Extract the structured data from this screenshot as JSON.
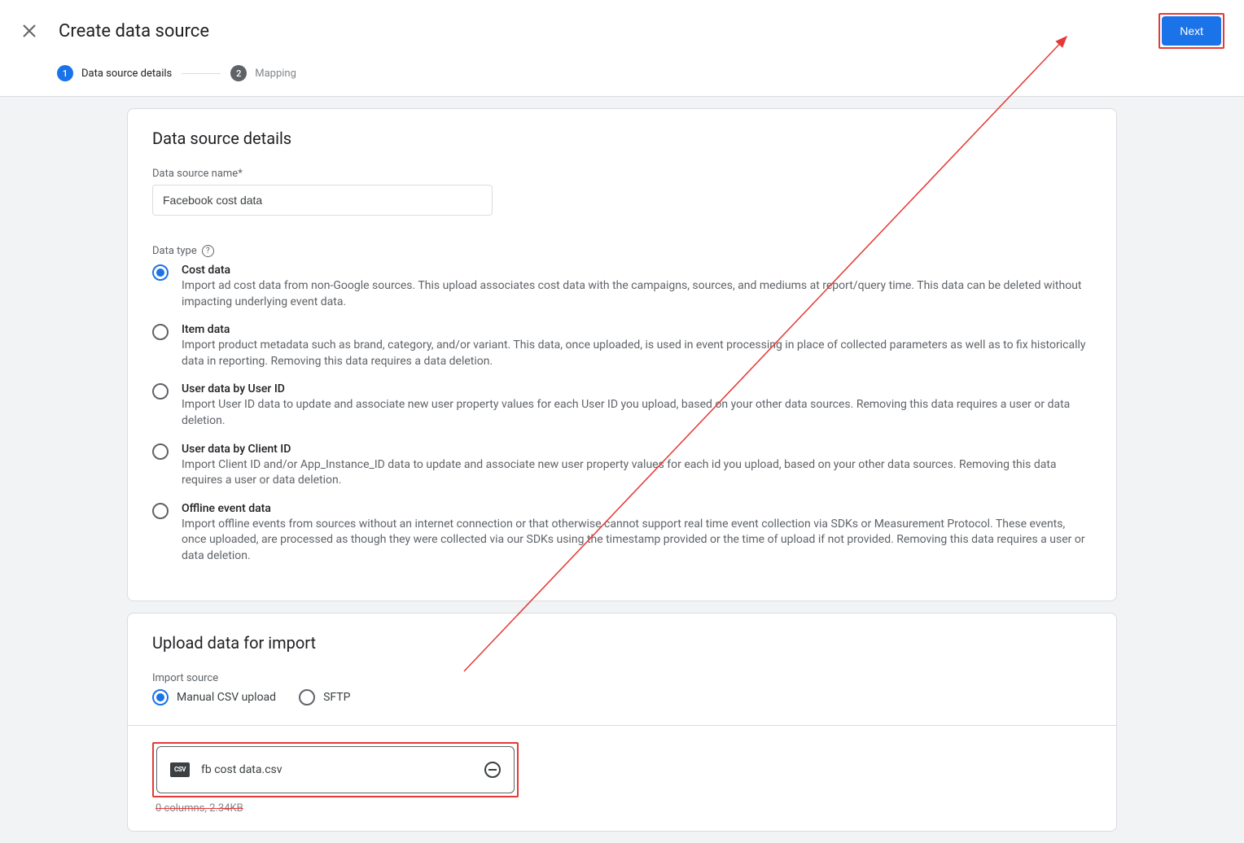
{
  "header": {
    "title": "Create data source",
    "next_label": "Next"
  },
  "stepper": {
    "step1": {
      "num": "1",
      "label": "Data source details"
    },
    "step2": {
      "num": "2",
      "label": "Mapping"
    }
  },
  "details": {
    "section_title": "Data source details",
    "name_label": "Data source name*",
    "name_value": "Facebook cost data",
    "type_label": "Data type",
    "options": [
      {
        "title": "Cost data",
        "desc": "Import ad cost data from non-Google sources. This upload associates cost data with the campaigns, sources, and mediums at report/query time. This data can be deleted without impacting underlying event data.",
        "selected": true
      },
      {
        "title": "Item data",
        "desc": "Import product metadata such as brand, category, and/or variant. This data, once uploaded, is used in event processing in place of collected parameters as well as to fix historically data in reporting. Removing this data requires a data deletion.",
        "selected": false
      },
      {
        "title": "User data by User ID",
        "desc": "Import User ID data to update and associate new user property values for each User ID you upload, based on your other data sources. Removing this data requires a user or data deletion.",
        "selected": false
      },
      {
        "title": "User data by Client ID",
        "desc": "Import Client ID and/or App_Instance_ID data to update and associate new user property values for each id you upload, based on your other data sources. Removing this data requires a user or data deletion.",
        "selected": false
      },
      {
        "title": "Offline event data",
        "desc": "Import offline events from sources without an internet connection or that otherwise cannot support real time event collection via SDKs or Measurement Protocol. These events, once uploaded, are processed as though they were collected via our SDKs using the timestamp provided or the time of upload if not provided. Removing this data requires a user or data deletion.",
        "selected": false
      }
    ]
  },
  "upload": {
    "section_title": "Upload data for import",
    "source_label": "Import source",
    "options": [
      {
        "label": "Manual CSV upload",
        "selected": true
      },
      {
        "label": "SFTP",
        "selected": false
      }
    ],
    "file": {
      "badge": "CSV",
      "name": "fb cost data.csv",
      "meta": "0 columns, 2.34KB"
    }
  }
}
